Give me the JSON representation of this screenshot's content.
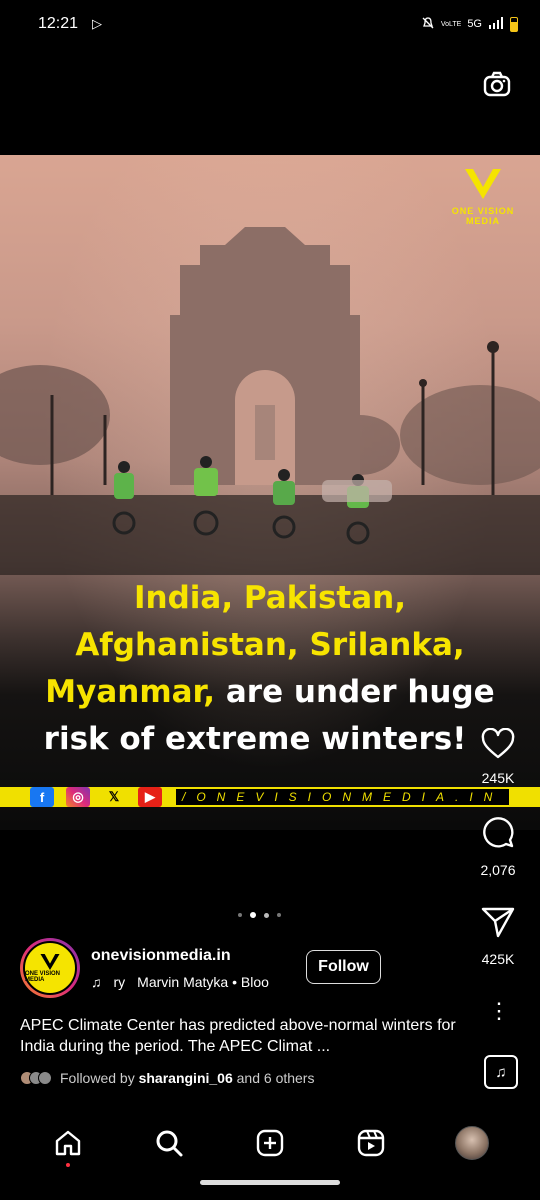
{
  "status_bar": {
    "time": "12:21",
    "network": "5G",
    "network_label": "VoLTE"
  },
  "post": {
    "brand_logo_text": "ONE VISION MEDIA",
    "headline_lines": [
      {
        "yellow": "India, Pakistan,",
        "white": ""
      },
      {
        "yellow": "Afghanistan, Srilanka,",
        "white": ""
      },
      {
        "yellow": "Myanmar,",
        "white": " are under huge"
      },
      {
        "yellow": "",
        "white": "risk of extreme winters!"
      }
    ],
    "strip_text": "/ONEVISIONMEDIA.IN",
    "social_icons": [
      "facebook-icon",
      "instagram-icon",
      "x-icon",
      "youtube-icon"
    ],
    "carousel": {
      "total": 4,
      "active": 1
    }
  },
  "actions": {
    "likes": "245K",
    "comments": "2,076",
    "shares": "425K"
  },
  "author": {
    "username": "onevisionmedia.in",
    "avatar_text": "ONE VISION MEDIA",
    "follow_label": "Follow",
    "audio_prefix": "ry",
    "audio_track": "Marvin Matyka • Bloo"
  },
  "caption": {
    "text": "APEC Climate Center has predicted above-normal winters for India during the period. The APEC Climat ...",
    "followed_prefix": "Followed by ",
    "followed_user": "sharangini_06",
    "followed_suffix": " and 6 others"
  },
  "nav": [
    "home-icon",
    "search-icon",
    "create-icon",
    "reels-icon",
    "profile"
  ],
  "colors": {
    "headline_yellow": "#f7e400",
    "strip_yellow": "#f0e000",
    "like_red": "#ff3040"
  }
}
